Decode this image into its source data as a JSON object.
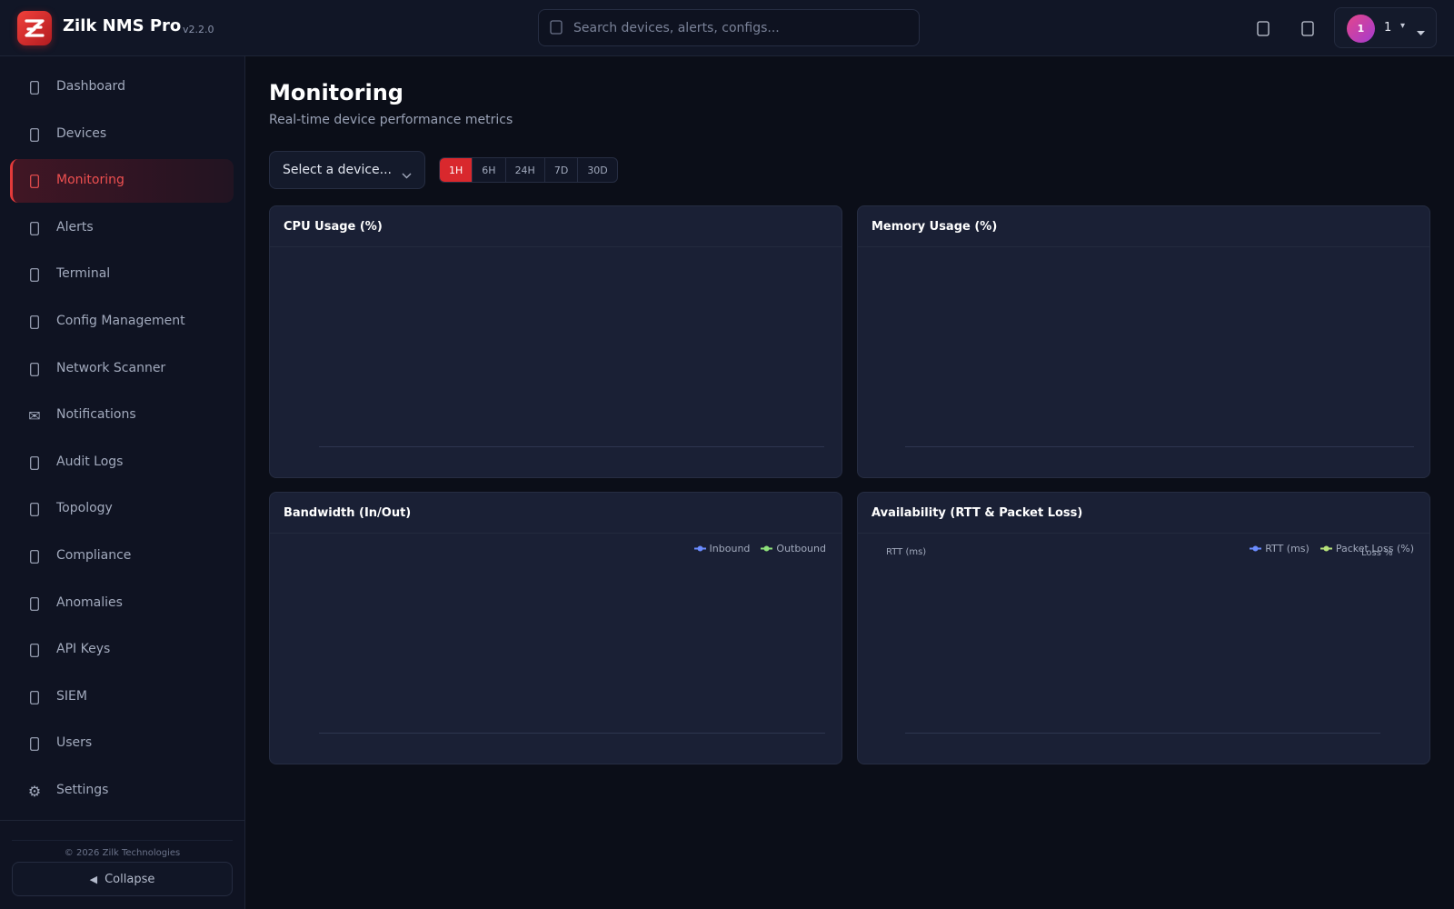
{
  "app": {
    "name": "Zilk NMS Pro",
    "version": "v2.2.0"
  },
  "search": {
    "placeholder": "Search devices, alerts, configs...",
    "icon": "search-icon"
  },
  "topbar": {
    "icons": [
      "bell-icon",
      "moon-icon"
    ]
  },
  "user": {
    "initial": "1",
    "name": "1",
    "caret": "▾"
  },
  "sidebar": {
    "items": [
      {
        "label": "Dashboard",
        "icon": "dashboard-icon"
      },
      {
        "label": "Devices",
        "icon": "server-icon"
      },
      {
        "label": "Monitoring",
        "icon": "chart-line-icon",
        "active": true
      },
      {
        "label": "Alerts",
        "icon": "bell-icon"
      },
      {
        "label": "Terminal",
        "icon": "terminal-icon"
      },
      {
        "label": "Config Management",
        "icon": "file-code-icon"
      },
      {
        "label": "Network Scanner",
        "icon": "radar-icon"
      },
      {
        "label": "Notifications",
        "icon": "envelope-icon"
      },
      {
        "label": "Audit Logs",
        "icon": "clipboard-icon"
      },
      {
        "label": "Topology",
        "icon": "sitemap-icon"
      },
      {
        "label": "Compliance",
        "icon": "shield-icon"
      },
      {
        "label": "Anomalies",
        "icon": "warning-icon"
      },
      {
        "label": "API Keys",
        "icon": "key-icon"
      },
      {
        "label": "SIEM",
        "icon": "lock-icon"
      },
      {
        "label": "Users",
        "icon": "users-icon"
      },
      {
        "label": "Settings",
        "icon": "gear-icon"
      }
    ],
    "copyright": "© 2026 Zilk Technologies",
    "collapse_label": "Collapse",
    "collapse_icon": "◀"
  },
  "main": {
    "title": "Monitoring",
    "subtitle": "Real-time device performance metrics",
    "device_select": {
      "value": "Select a device..."
    },
    "time_ranges": [
      {
        "label": "1H",
        "active": true
      },
      {
        "label": "6H",
        "active": false
      },
      {
        "label": "24H",
        "active": false
      },
      {
        "label": "7D",
        "active": false
      },
      {
        "label": "30D",
        "active": false
      }
    ],
    "cards": {
      "cpu": {
        "title": "CPU Usage (%)"
      },
      "memory": {
        "title": "Memory Usage (%)"
      },
      "bandwidth": {
        "title": "Bandwidth (In/Out)",
        "legend": [
          {
            "label": "Inbound",
            "color": "#6b8cff"
          },
          {
            "label": "Outbound",
            "color": "#8ee07a"
          }
        ]
      },
      "availability": {
        "title": "Availability (RTT & Packet Loss)",
        "legend": [
          {
            "label": "RTT (ms)",
            "color": "#6b8cff"
          },
          {
            "label": "Packet Loss (%)",
            "color": "#b7e27a"
          }
        ],
        "y_left_label": "RTT (ms)",
        "y_right_label": "Loss %"
      }
    }
  },
  "colors": {
    "accent": "#d9282d",
    "background": "#0b0e18",
    "panel": "#1a2035",
    "sidebar": "#0f1322"
  }
}
